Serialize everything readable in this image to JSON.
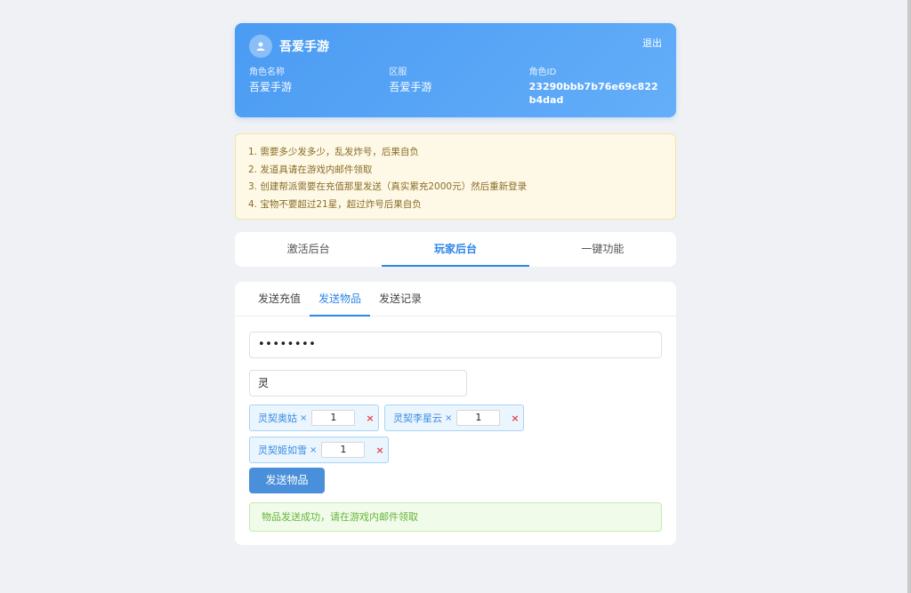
{
  "header": {
    "title": "吾爱手游",
    "logout_label": "退出",
    "role_name_label": "角色名称",
    "role_name_value": "吾爱手游",
    "server_label": "区服",
    "server_value": "吾爱手游",
    "role_id_label": "角色ID",
    "role_id_value": "23290bbb7b76e69c822b4dad"
  },
  "notice": {
    "lines": [
      "1. 需要多少发多少，乱发炸号，后果自负",
      "2. 发道具请在游戏内邮件领取",
      "3. 创建帮派需要在充值那里发送（真实累充2000元）然后重新登录",
      "4. 宝物不要超过21星，超过炸号后果自负"
    ]
  },
  "main_tabs": [
    {
      "label": "激活后台"
    },
    {
      "label": "玩家后台"
    },
    {
      "label": "一键功能"
    }
  ],
  "sub_tabs": [
    {
      "label": "发送充值"
    },
    {
      "label": "发送物品"
    },
    {
      "label": "发送记录"
    }
  ],
  "form": {
    "password_value": "••••••••",
    "search_value": "灵"
  },
  "items": [
    {
      "name": "灵契奥姑",
      "x": "×",
      "qty": "1",
      "remove": "×"
    },
    {
      "name": "灵契李星云",
      "x": "×",
      "qty": "1",
      "remove": "×"
    },
    {
      "name": "灵契姬如雪",
      "x": "×",
      "qty": "1",
      "remove": "×"
    }
  ],
  "send_button_label": "发送物品",
  "success_message": "物品发送成功，请在游戏内邮件领取",
  "colors": {
    "accent": "#2f86e6",
    "success": "#67b43c",
    "danger": "#e0474b"
  },
  "icons": {
    "avatar": "user-icon"
  }
}
